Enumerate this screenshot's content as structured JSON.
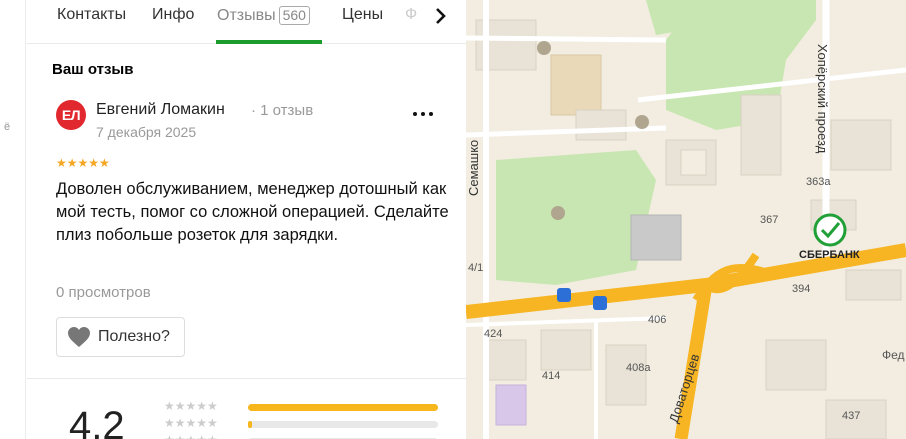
{
  "tabs": [
    {
      "label": "Контакты"
    },
    {
      "label": "Инфо"
    },
    {
      "label": "Отзывы",
      "badge": "560"
    },
    {
      "label": "Цены"
    },
    {
      "label": "Ф"
    }
  ],
  "section_title": "Ваш отзыв",
  "review": {
    "avatar_initials": "ЕЛ",
    "author": "Евгений Ломакин",
    "author_meta": "· 1 отзыв",
    "date": "7 декабря 2025",
    "rating": 5,
    "stars": "★★★★★",
    "text": "Доволен обслуживанием, менеджер дотошный как мой тесть, помог со сложной операцией. Сделайте плиз побольше розеток для зарядки.",
    "views": "0 просмотров",
    "helpful_label": "Полезно?"
  },
  "summary": {
    "rating": "4,2",
    "distribution": [
      {
        "stars": "★★★★★",
        "fraction": 1.0
      },
      {
        "stars": "★★★★★",
        "fraction": 0.02
      },
      {
        "stars": "★★★★★",
        "fraction": 0.0
      }
    ]
  },
  "map": {
    "streets": [
      "Хопёрский проезд",
      "Семашко",
      "Доваторцев"
    ],
    "buildings": [
      "363а",
      "367",
      "394",
      "406",
      "424",
      "414",
      "408а",
      "437",
      "4/1"
    ],
    "poi": "СБЕРБАНК",
    "poi_partial": "Фед",
    "colors": {
      "road": "#f7b523",
      "park": "#c8e6b1",
      "poi_green": "#21a038"
    }
  },
  "colors": {
    "accent": "#1b9c2c",
    "avatar": "#e1282e",
    "star": "#f5a623",
    "bar": "#f7b61c"
  },
  "icons": [
    "chevron-right-icon",
    "more-dots-icon",
    "heart-icon",
    "bus-stop-icon",
    "sberbank-logo-icon",
    "museum-icon"
  ]
}
